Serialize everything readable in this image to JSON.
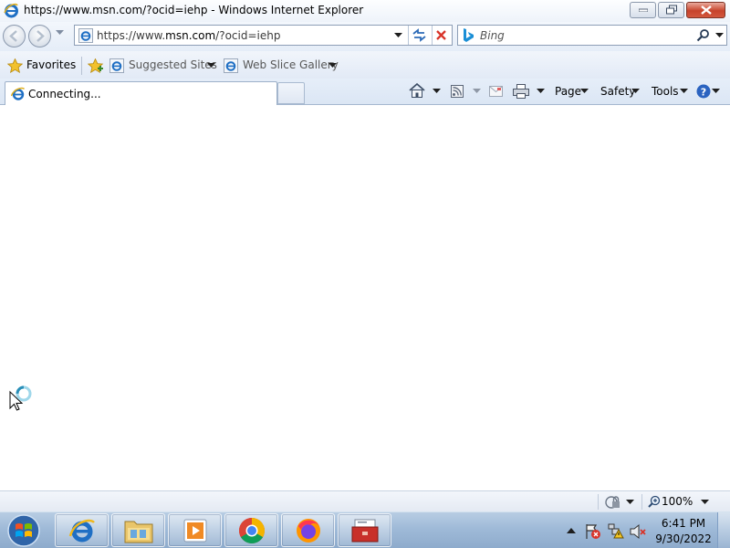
{
  "window": {
    "title": "https://www.msn.com/?ocid=iehp - Windows Internet Explorer"
  },
  "address_bar": {
    "url_prefix": "https://www.",
    "url_domain": "msn.com",
    "url_suffix": "/?ocid=iehp"
  },
  "search": {
    "placeholder": "Bing"
  },
  "favorites_bar": {
    "favorites_label": "Favorites",
    "items": [
      {
        "label": "Suggested Sites"
      },
      {
        "label": "Web Slice Gallery"
      }
    ]
  },
  "tab": {
    "title": "Connecting..."
  },
  "command_bar": {
    "page_label": "Page",
    "safety_label": "Safety",
    "tools_label": "Tools"
  },
  "status_bar": {
    "zoom": "100%"
  },
  "taskbar": {
    "time": "6:41 PM",
    "date": "9/30/2022",
    "apps": [
      "internet-explorer",
      "windows-explorer",
      "media-player",
      "chrome",
      "firefox",
      "toolbox-app"
    ]
  },
  "colors": {
    "stop_red": "#d8342a",
    "ie_blue": "#1f6fc4",
    "accent_chrome_bar": "#e4ecf7"
  }
}
